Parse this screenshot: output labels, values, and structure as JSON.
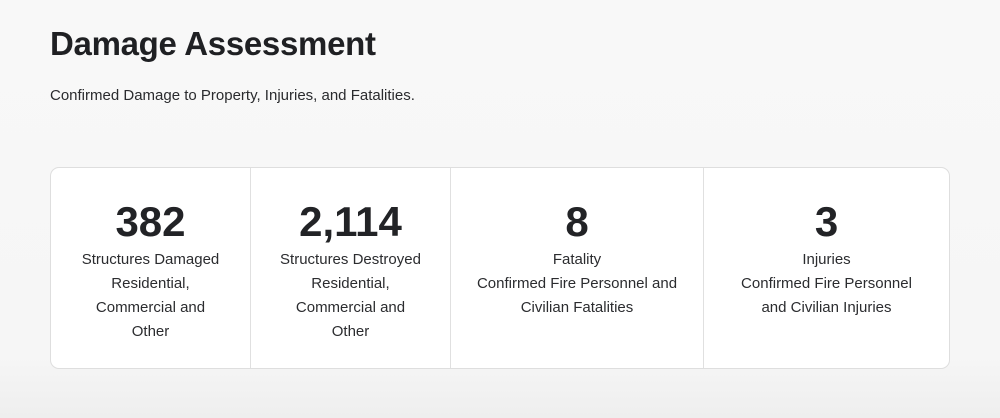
{
  "header": {
    "title": "Damage Assessment",
    "subtitle": "Confirmed Damage to Property, Injuries, and Fatalities."
  },
  "stats": [
    {
      "value": "382",
      "label": "Structures Damaged",
      "description": "Residential, Commercial and Other"
    },
    {
      "value": "2,114",
      "label": "Structures Destroyed",
      "description": "Residential, Commercial and Other"
    },
    {
      "value": "8",
      "label": "Fatality",
      "description": "Confirmed Fire Personnel and Civilian Fatalities"
    },
    {
      "value": "3",
      "label": "Injuries",
      "description": "Confirmed Fire Personnel and Civilian Injuries"
    }
  ]
}
